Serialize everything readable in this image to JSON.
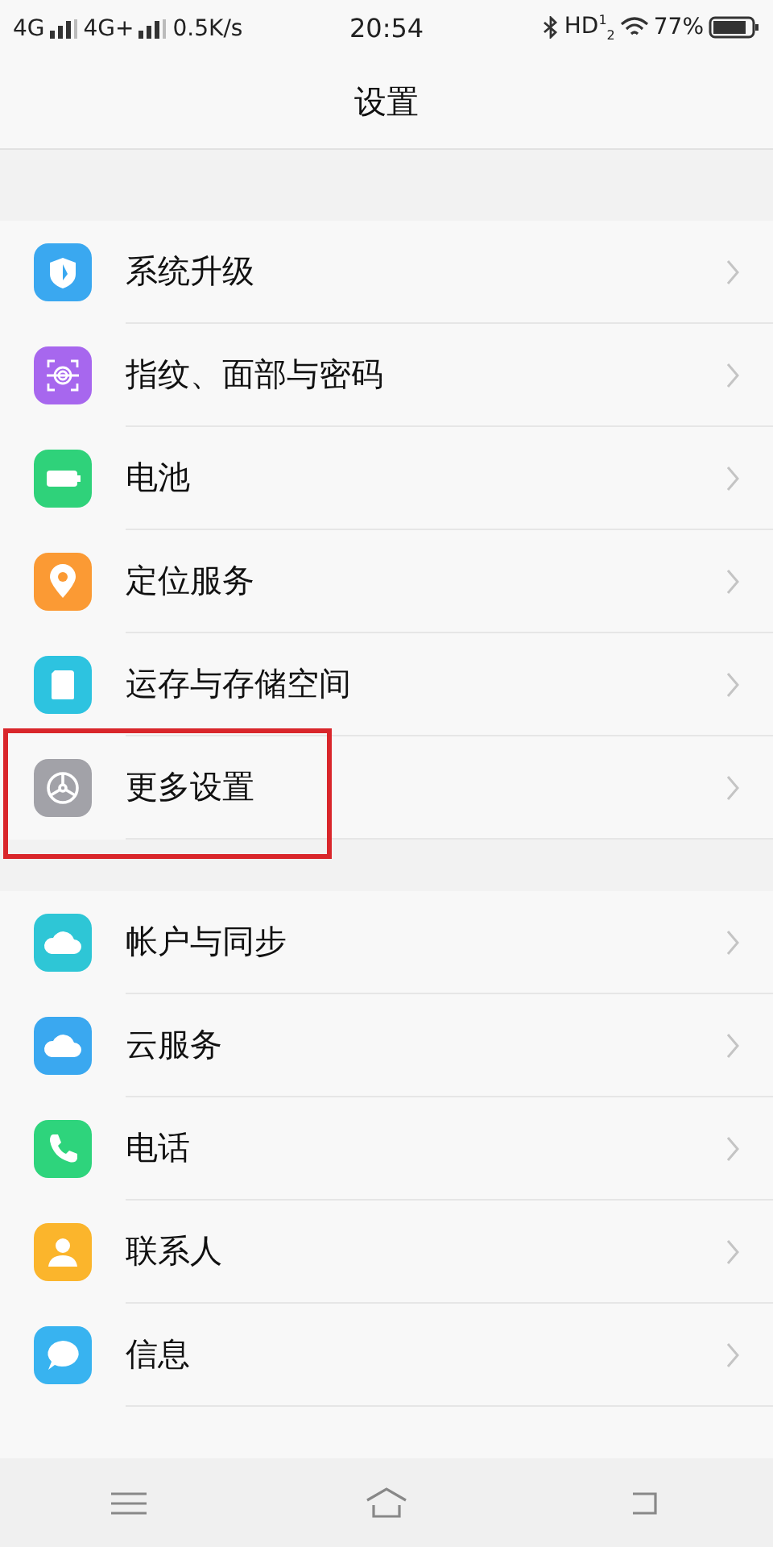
{
  "status_bar": {
    "network_1": "4G",
    "network_2": "4G+",
    "speed": "0.5K/s",
    "time": "20:54",
    "hd": "HD$^{1}$$_{2}$",
    "battery": "77%"
  },
  "header": {
    "title": "设置"
  },
  "groups": [
    {
      "items": [
        {
          "label": "系统升级",
          "kind": "shield",
          "color": "#3aa8f0",
          "highlighted": false
        },
        {
          "label": "指纹、面部与密码",
          "kind": "fingerprint",
          "color": "#a767ee",
          "highlighted": false
        },
        {
          "label": "电池",
          "kind": "battery",
          "color": "#2fd27a",
          "highlighted": false
        },
        {
          "label": "定位服务",
          "kind": "location",
          "color": "#fb9a34",
          "highlighted": false
        },
        {
          "label": "运存与存储空间",
          "kind": "sdcard",
          "color": "#2dc3e0",
          "highlighted": false
        },
        {
          "label": "更多设置",
          "kind": "gear",
          "color": "#a2a2a8",
          "highlighted": true
        }
      ]
    },
    {
      "items": [
        {
          "label": "帐户与同步",
          "kind": "cloud",
          "color": "#2ec6d6",
          "highlighted": false
        },
        {
          "label": "云服务",
          "kind": "cloud",
          "color": "#3aa8f0",
          "highlighted": false
        },
        {
          "label": "电话",
          "kind": "phone",
          "color": "#2ed47c",
          "highlighted": false
        },
        {
          "label": "联系人",
          "kind": "contact",
          "color": "#fbb52c",
          "highlighted": false
        },
        {
          "label": "信息",
          "kind": "message",
          "color": "#38b3f0",
          "highlighted": false
        }
      ]
    }
  ]
}
